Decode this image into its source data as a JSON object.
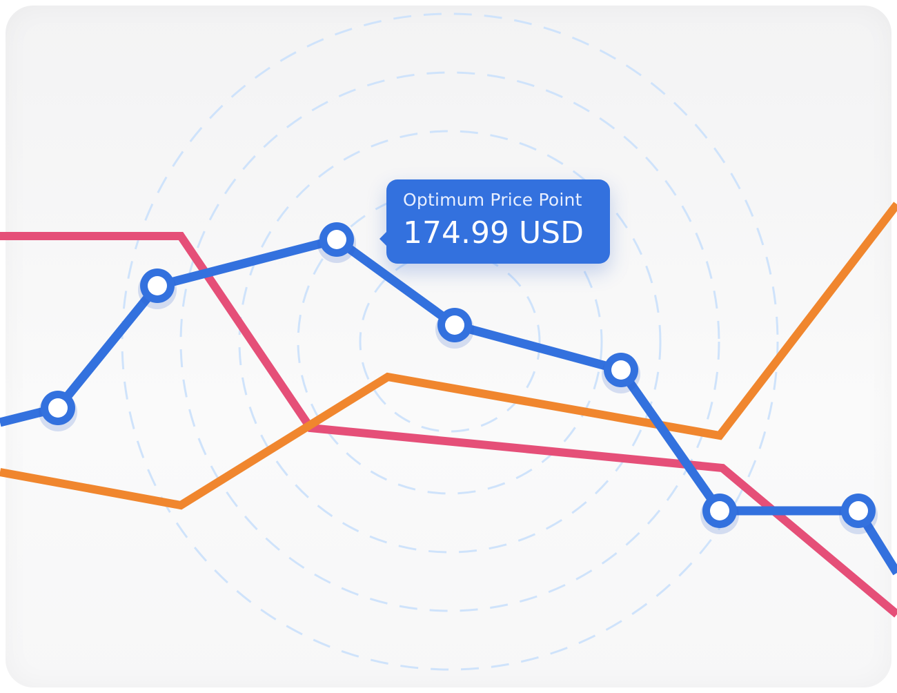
{
  "colors": {
    "blue": "#3371de",
    "pink": "#e54f78",
    "orange": "#f0862e",
    "rings": "#cfe3fb"
  },
  "tooltip": {
    "label": "Optimum Price Point",
    "value": "174.99 USD"
  },
  "chart_data": {
    "type": "line",
    "grid": "dashed concentric rings",
    "legend": "none",
    "series": [
      {
        "color": "#e54f78",
        "markers": false,
        "points": [
          [
            0,
            342
          ],
          [
            262,
            342
          ],
          [
            450,
            620
          ],
          [
            1047,
            678
          ],
          [
            1300,
            890
          ]
        ]
      },
      {
        "color": "#f0862e",
        "markers": false,
        "points": [
          [
            0,
            684
          ],
          [
            262,
            732
          ],
          [
            562,
            546
          ],
          [
            1043,
            631
          ],
          [
            1300,
            296
          ]
        ]
      },
      {
        "color": "#3371de",
        "markers": true,
        "highlight_index": 4,
        "points": [
          [
            0,
            612
          ],
          [
            84,
            591
          ],
          [
            228,
            414
          ],
          [
            488,
            347
          ],
          [
            659,
            471
          ],
          [
            900,
            536
          ],
          [
            1043,
            740
          ],
          [
            1244,
            740
          ],
          [
            1300,
            830
          ]
        ]
      }
    ]
  }
}
